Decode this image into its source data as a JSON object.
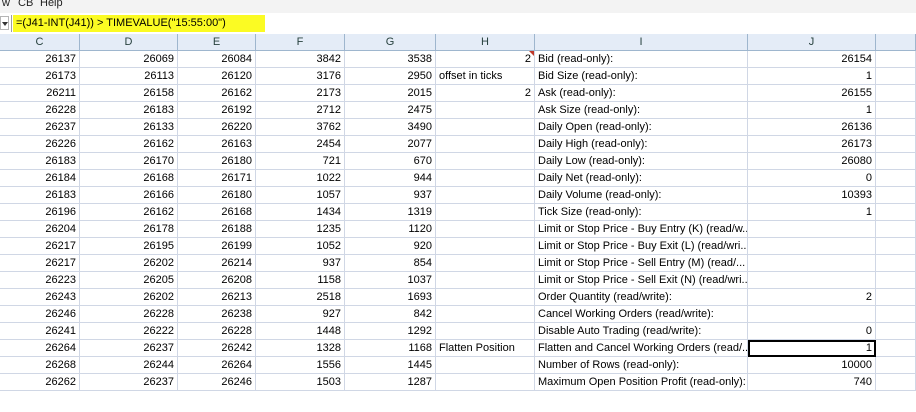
{
  "menu": [
    "w",
    "CB",
    "Help"
  ],
  "formula": "=(J41-INT(J41)) > TIMEVALUE(\"15:55:00\")",
  "columns": [
    "C",
    "D",
    "E",
    "F",
    "G",
    "H",
    "I",
    "J"
  ],
  "rows": [
    {
      "C": "26137",
      "D": "26069",
      "E": "26084",
      "F": "3842",
      "G": "3538",
      "H": "2",
      "I": "Bid (read-only):",
      "J": "26154"
    },
    {
      "C": "26173",
      "D": "26113",
      "E": "26120",
      "F": "3176",
      "G": "2950",
      "H": "offset in ticks",
      "I": "Bid Size (read-only):",
      "J": "1"
    },
    {
      "C": "26211",
      "D": "26158",
      "E": "26162",
      "F": "2173",
      "G": "2015",
      "H": "2",
      "I": "Ask (read-only):",
      "J": "26155"
    },
    {
      "C": "26228",
      "D": "26183",
      "E": "26192",
      "F": "2712",
      "G": "2475",
      "H": "",
      "I": "Ask Size (read-only):",
      "J": "1"
    },
    {
      "C": "26237",
      "D": "26133",
      "E": "26220",
      "F": "3762",
      "G": "3490",
      "H": "",
      "I": "Daily Open (read-only):",
      "J": "26136"
    },
    {
      "C": "26226",
      "D": "26162",
      "E": "26163",
      "F": "2454",
      "G": "2077",
      "H": "",
      "I": "Daily High (read-only):",
      "J": "26173"
    },
    {
      "C": "26183",
      "D": "26170",
      "E": "26180",
      "F": "721",
      "G": "670",
      "H": "",
      "I": "Daily Low (read-only):",
      "J": "26080"
    },
    {
      "C": "26184",
      "D": "26168",
      "E": "26171",
      "F": "1022",
      "G": "944",
      "H": "",
      "I": "Daily Net (read-only):",
      "J": "0"
    },
    {
      "C": "26183",
      "D": "26166",
      "E": "26180",
      "F": "1057",
      "G": "937",
      "H": "",
      "I": "Daily Volume (read-only):",
      "J": "10393"
    },
    {
      "C": "26196",
      "D": "26162",
      "E": "26168",
      "F": "1434",
      "G": "1319",
      "H": "",
      "I": "Tick Size (read-only):",
      "J": "1"
    },
    {
      "C": "26204",
      "D": "26178",
      "E": "26188",
      "F": "1235",
      "G": "1120",
      "H": "",
      "I": "Limit or Stop Price - Buy Entry (K) (read/w...",
      "J": ""
    },
    {
      "C": "26217",
      "D": "26195",
      "E": "26199",
      "F": "1052",
      "G": "920",
      "H": "",
      "I": "Limit or Stop Price - Buy Exit (L) (read/wri...",
      "J": ""
    },
    {
      "C": "26217",
      "D": "26202",
      "E": "26214",
      "F": "937",
      "G": "854",
      "H": "",
      "I": "Limit or Stop Price - Sell Entry (M) (read/...",
      "J": ""
    },
    {
      "C": "26223",
      "D": "26205",
      "E": "26208",
      "F": "1158",
      "G": "1037",
      "H": "",
      "I": "Limit or Stop Price - Sell Exit (N) (read/wri...",
      "J": ""
    },
    {
      "C": "26243",
      "D": "26202",
      "E": "26213",
      "F": "2518",
      "G": "1693",
      "H": "",
      "I": "Order Quantity (read/write):",
      "J": "2"
    },
    {
      "C": "26246",
      "D": "26228",
      "E": "26238",
      "F": "927",
      "G": "842",
      "H": "",
      "I": "Cancel Working Orders (read/write):",
      "J": ""
    },
    {
      "C": "26241",
      "D": "26222",
      "E": "26228",
      "F": "1448",
      "G": "1292",
      "H": "",
      "I": "Disable Auto Trading (read/write):",
      "J": "0"
    },
    {
      "C": "26264",
      "D": "26237",
      "E": "26242",
      "F": "1328",
      "G": "1168",
      "H": "Flatten Position",
      "I": "Flatten and Cancel Working Orders (read/...",
      "J": "1"
    },
    {
      "C": "26268",
      "D": "26244",
      "E": "26264",
      "F": "1556",
      "G": "1445",
      "H": "",
      "I": "Number of Rows (read-only):",
      "J": "10000"
    },
    {
      "C": "26262",
      "D": "26237",
      "E": "26246",
      "F": "1503",
      "G": "1287",
      "H": "",
      "I": "Maximum Open Position Profit (read-only):",
      "J": "740"
    }
  ]
}
